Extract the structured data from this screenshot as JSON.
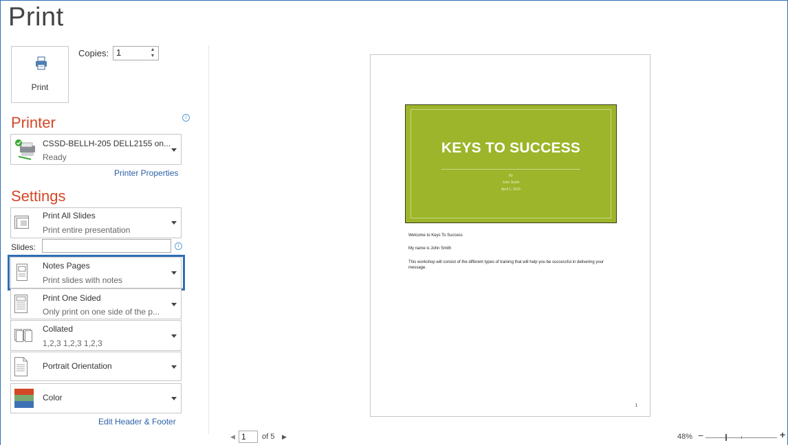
{
  "page_title": "Print",
  "print_button": {
    "label": "Print",
    "icon": "printer-icon"
  },
  "copies": {
    "label": "Copies:",
    "value": "1"
  },
  "printer": {
    "heading": "Printer",
    "name": "CSSD-BELLH-205 DELL2155 on...",
    "status": "Ready",
    "properties_link": "Printer Properties"
  },
  "settings": {
    "heading": "Settings",
    "print_range": {
      "title": "Print All Slides",
      "subtitle": "Print entire presentation"
    },
    "slides_label": "Slides:",
    "slides_value": "",
    "layout": {
      "title": "Notes Pages",
      "subtitle": "Print slides with notes"
    },
    "sides": {
      "title": "Print One Sided",
      "subtitle": "Only print on one side of the p..."
    },
    "collation": {
      "title": "Collated",
      "subtitle": "1,2,3   1,2,3   1,2,3"
    },
    "orientation": {
      "title": "Portrait Orientation"
    },
    "color": {
      "title": "Color"
    },
    "header_footer_link": "Edit Header & Footer"
  },
  "preview": {
    "slide_title": "KEYS TO SUCCESS",
    "slide_by": "By",
    "slide_author": "John Smith",
    "slide_date": "April 1, 2015",
    "slide_color": "#9cb52a",
    "notes": [
      "Welcome to Keys To Success",
      "My name is John Smith",
      "This workshop will consist of the different types of training that will help you be successful in delivering your message."
    ],
    "page_number": "1"
  },
  "navigation": {
    "current_page": "1",
    "total_label": "of 5"
  },
  "zoom": {
    "level": "48%"
  },
  "colors": {
    "accent": "#d24726",
    "selection": "#2f6db5",
    "link": "#2a5fa5"
  }
}
